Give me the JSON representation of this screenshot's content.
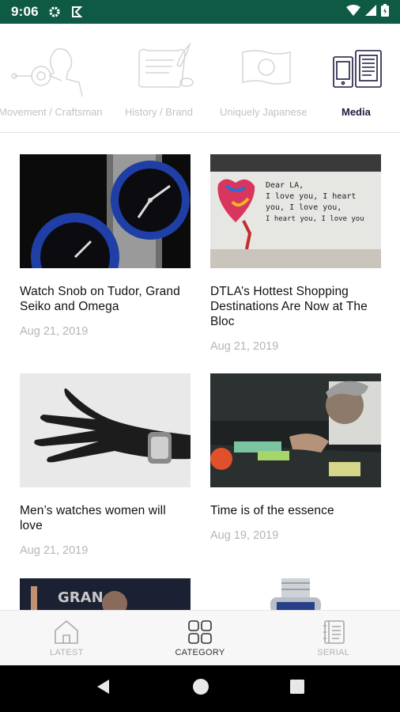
{
  "status_bar": {
    "time": "9:06"
  },
  "categories": [
    {
      "label": "Movement / Craftsman",
      "icon": "craftsman-icon"
    },
    {
      "label": "History / Brand",
      "icon": "scroll-quill-icon"
    },
    {
      "label": "Uniquely Japanese",
      "icon": "japan-flag-icon"
    },
    {
      "label": "Media",
      "icon": "media-devices-icon",
      "active": true
    }
  ],
  "articles": [
    {
      "title": "Watch Snob on Tudor, Grand Seiko and Omega",
      "date": "Aug 21, 2019",
      "image": "watches-photo"
    },
    {
      "title": "DTLA’s Hottest Shopping Destinations Are Now at The Bloc",
      "date": "Aug 21, 2019",
      "image": "mural-photo"
    },
    {
      "title": "Men’s watches women will love",
      "date": "Aug 21, 2019",
      "image": "hand-watch-photo"
    },
    {
      "title": "Time is of the essence",
      "date": "Aug 19, 2019",
      "image": "watchmaker-photo"
    }
  ],
  "mural_text": [
    "Dear LA,",
    "I love you, I heart",
    "you, I love you,",
    "I heart you, I love you"
  ],
  "partial_thumb_text": "GRAN",
  "bottom_nav": [
    {
      "label": "LATEST",
      "icon": "home-icon"
    },
    {
      "label": "CATEGORY",
      "icon": "grid-icon",
      "active": true
    },
    {
      "label": "SERIAL",
      "icon": "book-icon"
    }
  ],
  "colors": {
    "status_bar": "#0f5a44",
    "active_category": "#1c1c40"
  }
}
